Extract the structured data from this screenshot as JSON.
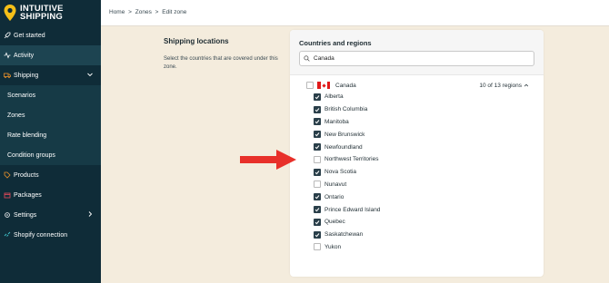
{
  "brand": {
    "line1": "INTUITIVE",
    "line2": "SHIPPING",
    "accent": "#f5c018"
  },
  "sidebar": {
    "items": [
      {
        "label": "Get started",
        "icon": "rocket-icon"
      },
      {
        "label": "Activity",
        "icon": "activity-icon"
      },
      {
        "label": "Shipping",
        "icon": "truck-icon"
      },
      {
        "label": "Scenarios",
        "icon": ""
      },
      {
        "label": "Zones",
        "icon": ""
      },
      {
        "label": "Rate blending",
        "icon": ""
      },
      {
        "label": "Condition groups",
        "icon": ""
      },
      {
        "label": "Products",
        "icon": "tag-icon"
      },
      {
        "label": "Packages",
        "icon": "box-icon"
      },
      {
        "label": "Settings",
        "icon": "gear-icon"
      },
      {
        "label": "Shopify connection",
        "icon": "link-icon"
      }
    ]
  },
  "breadcrumb": {
    "home": "Home",
    "sep": ">",
    "zones": "Zones",
    "edit": "Edit zone"
  },
  "section": {
    "title": "Shipping locations",
    "description": "Select the countries that are covered under this zone."
  },
  "card": {
    "title": "Countries and regions",
    "search_value": "Canada",
    "country": {
      "name": "Canada",
      "checked": false,
      "region_count": "10 of 13 regions"
    },
    "regions": [
      {
        "name": "Alberta",
        "checked": true
      },
      {
        "name": "British Columbia",
        "checked": true
      },
      {
        "name": "Manitoba",
        "checked": true
      },
      {
        "name": "New Brunswick",
        "checked": true
      },
      {
        "name": "Newfoundland",
        "checked": true
      },
      {
        "name": "Northwest Territories",
        "checked": false
      },
      {
        "name": "Nova Scotia",
        "checked": true
      },
      {
        "name": "Nunavut",
        "checked": false
      },
      {
        "name": "Ontario",
        "checked": true
      },
      {
        "name": "Prince Edward Island",
        "checked": true
      },
      {
        "name": "Quebec",
        "checked": true
      },
      {
        "name": "Saskatchewan",
        "checked": true
      },
      {
        "name": "Yukon",
        "checked": false
      }
    ]
  },
  "colors": {
    "sidebar": "#0f2c38",
    "background": "#f4ecdd",
    "arrow": "#e8302a",
    "checkbox": "#2a3f4a"
  }
}
